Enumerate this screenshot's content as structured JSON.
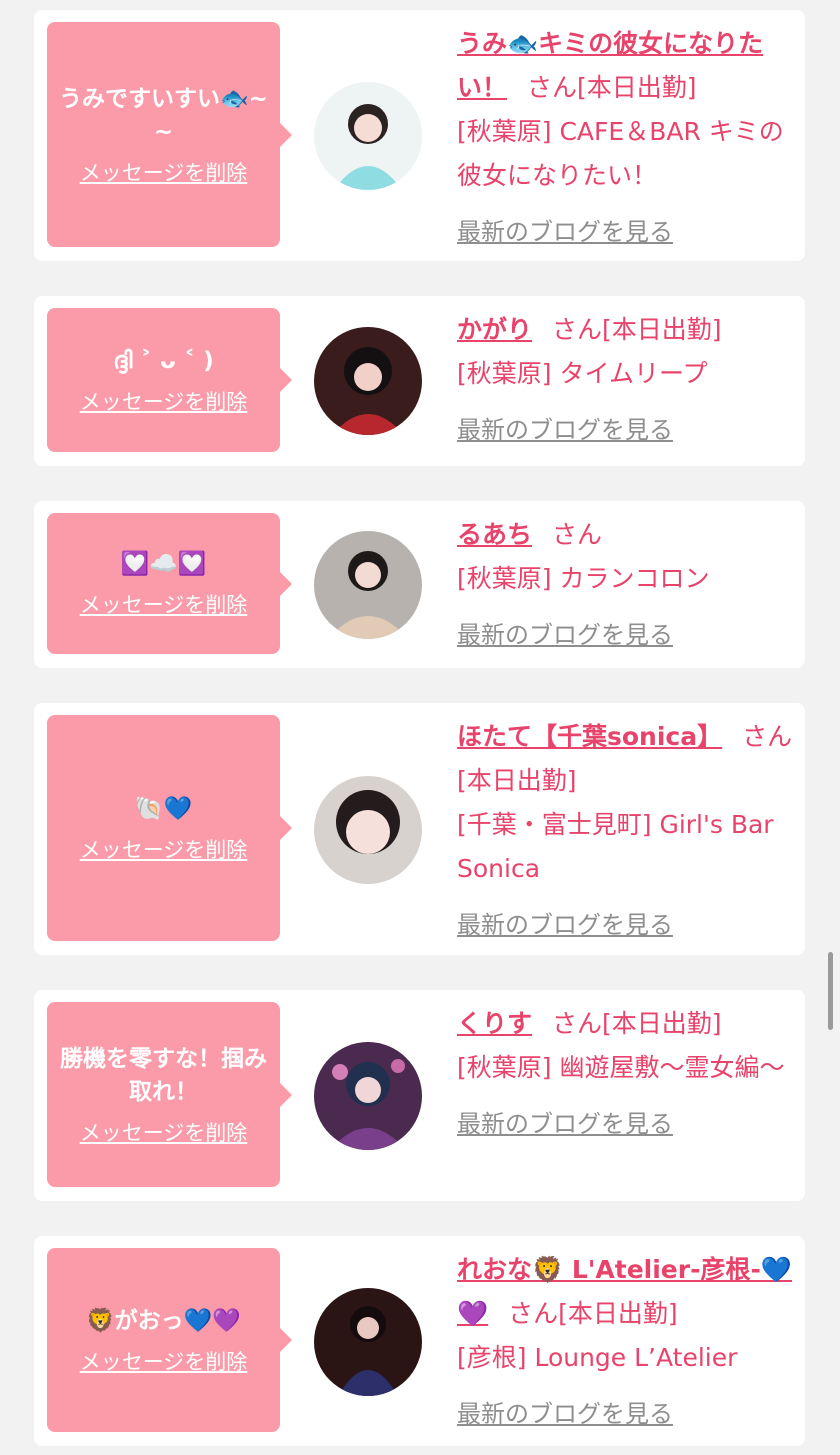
{
  "delete_label": "メッセージを削除",
  "blog_label": "最新のブログを見る",
  "san_suffix": "さん",
  "colors": {
    "accent": "#e8436b",
    "bubble": "#fb9aa8",
    "card": "#ffffff",
    "background": "#f2f2f2",
    "link_gray": "#8e8e8e"
  },
  "cards": [
    {
      "message": "うみですいすい🐟~~",
      "name": "うみ🐟キミの彼女になりたい！",
      "status": "[本日出勤]",
      "shop": "[秋葉原] CAFE＆BAR キミの彼女になりたい！",
      "avatar_icon": "portrait-photo-light"
    },
    {
      "message": "ദ്ദി ˃ ᴗ ˂ )",
      "name": "かがり",
      "status": "[本日出勤]",
      "shop": "[秋葉原] タイムリープ",
      "avatar_icon": "portrait-photo-dark"
    },
    {
      "message": "💟☁️💟",
      "name": "るあち",
      "status": "",
      "shop": "[秋葉原] カランコロン",
      "avatar_icon": "portrait-photo-beige"
    },
    {
      "message": "🐚💙",
      "name": "ほたて【千葉sonica】",
      "status": "[本日出勤]",
      "shop": "[千葉・富士見町] Girl's Bar Sonica",
      "avatar_icon": "portrait-photo-closeup"
    },
    {
      "message": "勝機を零すな！掴み取れ！",
      "name": "くりす",
      "status": "[本日出勤]",
      "shop": "[秋葉原] 幽遊屋敷〜霊女編〜",
      "avatar_icon": "portrait-photo-purple"
    },
    {
      "message": "🦁がおっ💙💜",
      "name": "れおな🦁 L'Atelier-彦根-💙💜",
      "status": "[本日出勤]",
      "shop": "[彦根] Lounge L’Atelier",
      "avatar_icon": "portrait-photo-navy"
    }
  ]
}
